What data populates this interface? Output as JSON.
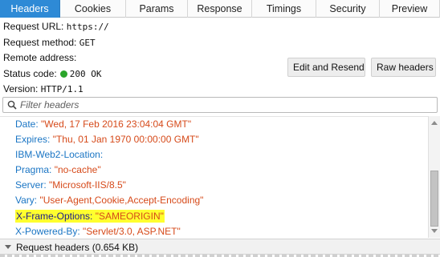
{
  "tabs": [
    {
      "label": "Headers",
      "active": true
    },
    {
      "label": "Cookies",
      "active": false
    },
    {
      "label": "Params",
      "active": false
    },
    {
      "label": "Response",
      "active": false
    },
    {
      "label": "Timings",
      "active": false
    },
    {
      "label": "Security",
      "active": false
    },
    {
      "label": "Preview",
      "active": false
    }
  ],
  "summary": {
    "url_label": "Request URL:",
    "url_value": "https://",
    "method_label": "Request method:",
    "method_value": "GET",
    "remote_label": "Remote address:",
    "remote_value": "",
    "status_label": "Status code:",
    "status_value": "200 OK",
    "version_label": "Version:",
    "version_value": "HTTP/1.1"
  },
  "buttons": {
    "edit_resend": "Edit and Resend",
    "raw_headers": "Raw headers"
  },
  "filter": {
    "placeholder": "Filter headers"
  },
  "headers": [
    {
      "name": "Date",
      "value": "\"Wed, 17 Feb 2016 23:04:04 GMT\"",
      "highlight": false
    },
    {
      "name": "Expires",
      "value": "\"Thu, 01 Jan 1970 00:00:00 GMT\"",
      "highlight": false
    },
    {
      "name": "IBM-Web2-Location",
      "value": "",
      "highlight": false
    },
    {
      "name": "Pragma",
      "value": "\"no-cache\"",
      "highlight": false
    },
    {
      "name": "Server",
      "value": "\"Microsoft-IIS/8.5\"",
      "highlight": false
    },
    {
      "name": "Vary",
      "value": "\"User-Agent,Cookie,Accept-Encoding\"",
      "highlight": false
    },
    {
      "name": "X-Frame-Options",
      "value": "\"SAMEORIGIN\"",
      "highlight": true
    },
    {
      "name": "X-Powered-By",
      "value": "\"Servlet/3.0, ASP.NET\"",
      "highlight": false
    }
  ],
  "section": {
    "label": "Request headers (0.654 KB)"
  },
  "colors": {
    "active_tab": "#2e8ad6",
    "header_name": "#1a75c4",
    "header_value": "#d64a1a",
    "highlight": "#ffff2e",
    "status_ok": "#2aa52a"
  }
}
